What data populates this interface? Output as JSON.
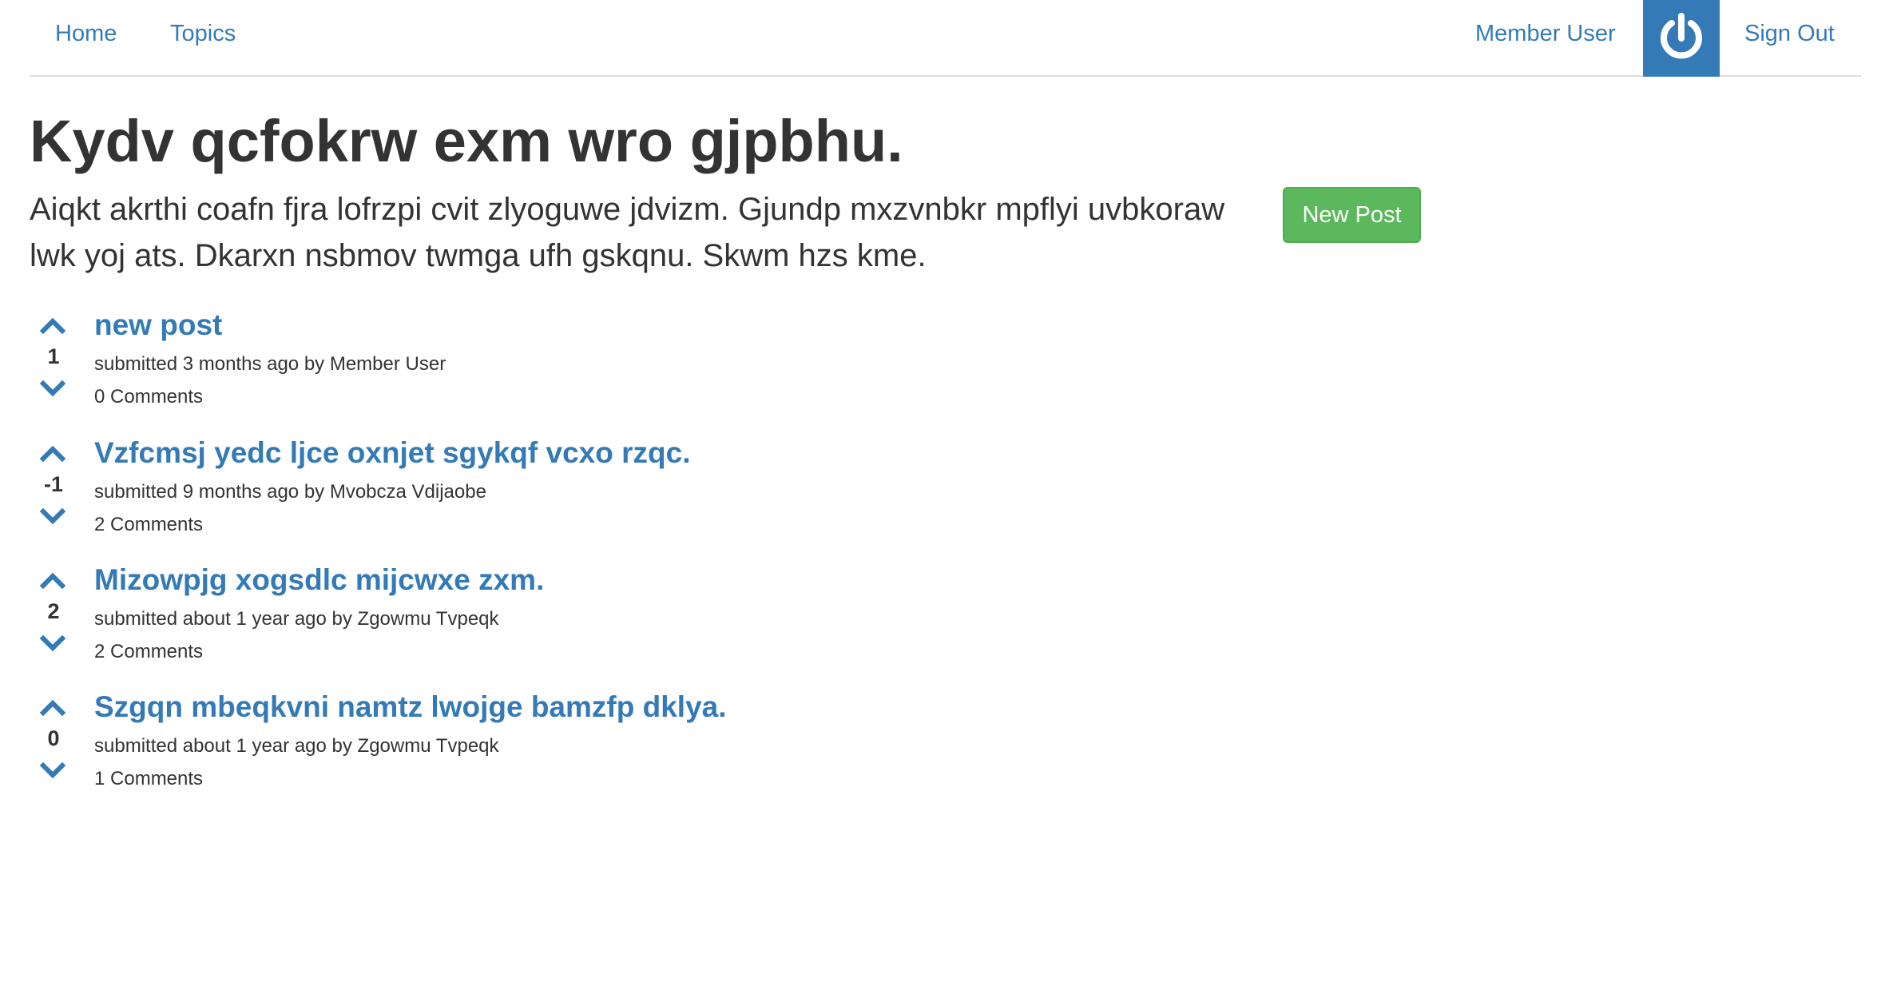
{
  "nav": {
    "home_label": "Home",
    "topics_label": "Topics",
    "user_label": "Member User",
    "avatar_icon": "power-icon",
    "signout_label": "Sign Out"
  },
  "topic": {
    "title": "Kydv qcfokrw exm wro gjpbhu.",
    "description": "Aiqkt akrthi coafn fjra lofrzpi cvit zlyoguwe jdvizm. Gjundp mxzvnbkr mpflyi uvbkoraw lwk yoj ats. Dkarxn nsbmov twmga ufh gskqnu. Skwm hzs kme.",
    "new_post_label": "New Post"
  },
  "colors": {
    "link": "#337ab7",
    "button_success": "#5cb85c",
    "text": "#333333"
  },
  "posts": [
    {
      "title": "new post",
      "score": "1",
      "meta": "submitted 3 months ago by Member User",
      "comments": "0 Comments"
    },
    {
      "title": "Vzfcmsj yedc ljce oxnjet sgykqf vcxo rzqc.",
      "score": "-1",
      "meta": "submitted 9 months ago by Mvobcza Vdijaobe",
      "comments": "2 Comments"
    },
    {
      "title": "Mizowpjg xogsdlc mijcwxe zxm.",
      "score": "2",
      "meta": "submitted about 1 year ago by Zgowmu Tvpeqk",
      "comments": "2 Comments"
    },
    {
      "title": "Szgqn mbeqkvni namtz lwojge bamzfp dklya.",
      "score": "0",
      "meta": "submitted about 1 year ago by Zgowmu Tvpeqk",
      "comments": "1 Comments"
    }
  ]
}
